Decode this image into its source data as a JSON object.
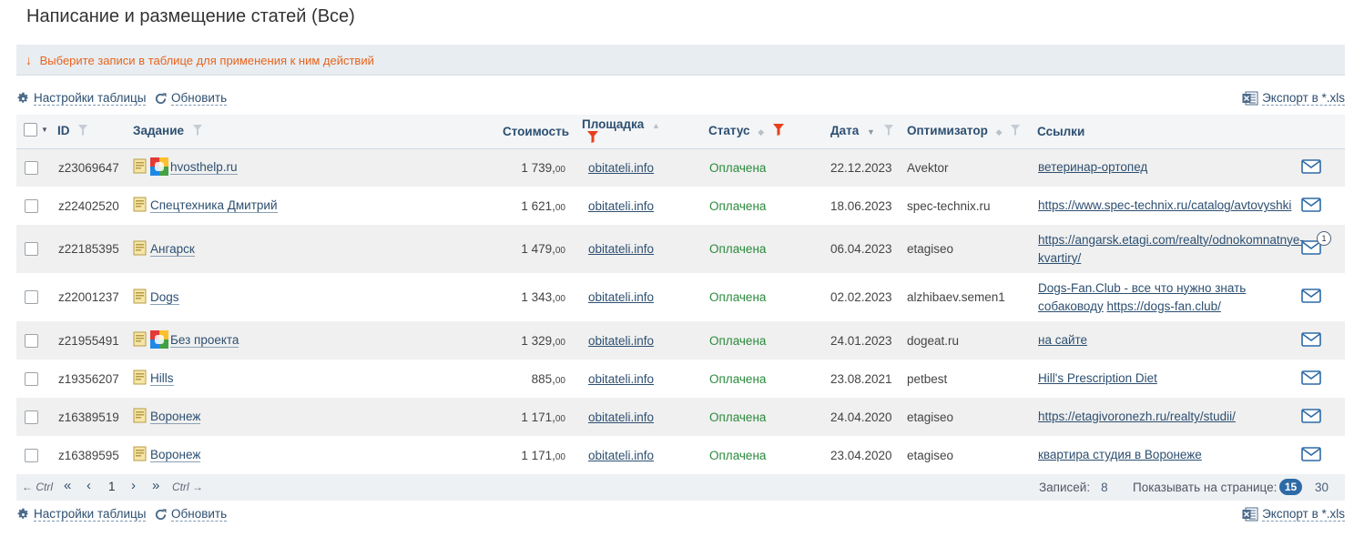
{
  "page": {
    "title": "Написание и размещение статей (Все)"
  },
  "notice": {
    "arrow": "↓",
    "text": "Выберите записи в таблице для применения к ним действий"
  },
  "toolbar": {
    "settings_label": "Настройки таблицы",
    "refresh_label": "Обновить",
    "export_label": "Экспорт в *.xls"
  },
  "table": {
    "columns": {
      "id": "ID",
      "task": "Задание",
      "cost": "Стоимость",
      "site": "Площадка",
      "status": "Статус",
      "date": "Дата",
      "optimizer": "Оптимизатор",
      "links": "Ссылки"
    },
    "rows": [
      {
        "id": "z23069647",
        "task": "hvosthelp.ru",
        "has_project_icon": true,
        "cost_int": "1 739,",
        "cost_dec": "00",
        "site": "obitateli.info",
        "status": "Оплачена",
        "date": "22.12.2023",
        "optimizer": "Avektor",
        "link1": "ветеринар-ортопед",
        "link2": "",
        "link3": "",
        "badge": ""
      },
      {
        "id": "z22402520",
        "task": "Спецтехника Дмитрий",
        "has_project_icon": false,
        "cost_int": "1 621,",
        "cost_dec": "00",
        "site": "obitateli.info",
        "status": "Оплачена",
        "date": "18.06.2023",
        "optimizer": "spec-technix.ru",
        "link1": "https://www.spec-technix.ru/catalog/avtovyshki",
        "link2": "",
        "link3": "",
        "badge": ""
      },
      {
        "id": "z22185395",
        "task": "Ангарск",
        "has_project_icon": false,
        "cost_int": "1 479,",
        "cost_dec": "00",
        "site": "obitateli.info",
        "status": "Оплачена",
        "date": "06.04.2023",
        "optimizer": "etagiseo",
        "link1": "https://angarsk.etagi.com/realty/odnokomnatnye-",
        "link2": "kvartiry/",
        "link3": "",
        "badge": "1"
      },
      {
        "id": "z22001237",
        "task": "Dogs",
        "has_project_icon": false,
        "cost_int": "1 343,",
        "cost_dec": "00",
        "site": "obitateli.info",
        "status": "Оплачена",
        "date": "02.02.2023",
        "optimizer": "alzhibaev.semen1",
        "link1": "Dogs-Fan.Club - все что нужно знать",
        "link2": "собаководу",
        "link3": "https://dogs-fan.club/",
        "badge": ""
      },
      {
        "id": "z21955491",
        "task": "Без проекта",
        "has_project_icon": true,
        "cost_int": "1 329,",
        "cost_dec": "00",
        "site": "obitateli.info",
        "status": "Оплачена",
        "date": "24.01.2023",
        "optimizer": "dogeat.ru",
        "link1": "на сайте",
        "link2": "",
        "link3": "",
        "badge": ""
      },
      {
        "id": "z19356207",
        "task": "Hills",
        "has_project_icon": false,
        "cost_int": "885,",
        "cost_dec": "00",
        "site": "obitateli.info",
        "status": "Оплачена",
        "date": "23.08.2021",
        "optimizer": "petbest",
        "link1": "Hill's Prescription Diet",
        "link2": "",
        "link3": "",
        "badge": ""
      },
      {
        "id": "z16389519",
        "task": "Воронеж",
        "has_project_icon": false,
        "cost_int": "1 171,",
        "cost_dec": "00",
        "site": "obitateli.info",
        "status": "Оплачена",
        "date": "24.04.2020",
        "optimizer": "etagiseo",
        "link1": "https://etagivoronezh.ru/realty/studii/",
        "link2": "",
        "link3": "",
        "badge": ""
      },
      {
        "id": "z16389595",
        "task": "Воронеж",
        "has_project_icon": false,
        "cost_int": "1 171,",
        "cost_dec": "00",
        "site": "obitateli.info",
        "status": "Оплачена",
        "date": "23.04.2020",
        "optimizer": "etagiseo",
        "link1": "квартира студия в Воронеже",
        "link2": "",
        "link3": "",
        "badge": ""
      }
    ]
  },
  "pager": {
    "prev_hint": "← Ctrl",
    "first": "«",
    "prev": "‹",
    "current_page": "1",
    "next": "›",
    "last": "»",
    "next_hint": "Ctrl →",
    "records_label": "Записей:",
    "records_count": "8",
    "per_page_label": "Показывать на странице:",
    "per_page_selected": "15",
    "per_page_other": "30"
  },
  "colors": {
    "accent": "#2d4f70",
    "notice": "#e8641b",
    "status_paid": "#2a8a3c",
    "filter_active": "#e8401b",
    "pager_active": "#2d6aa6"
  },
  "icons": {
    "settings": "gear-icon",
    "refresh": "refresh-icon",
    "export": "excel-icon",
    "filter": "filter-icon",
    "message": "envelope-icon",
    "document": "document-icon",
    "project": "project-icon"
  }
}
